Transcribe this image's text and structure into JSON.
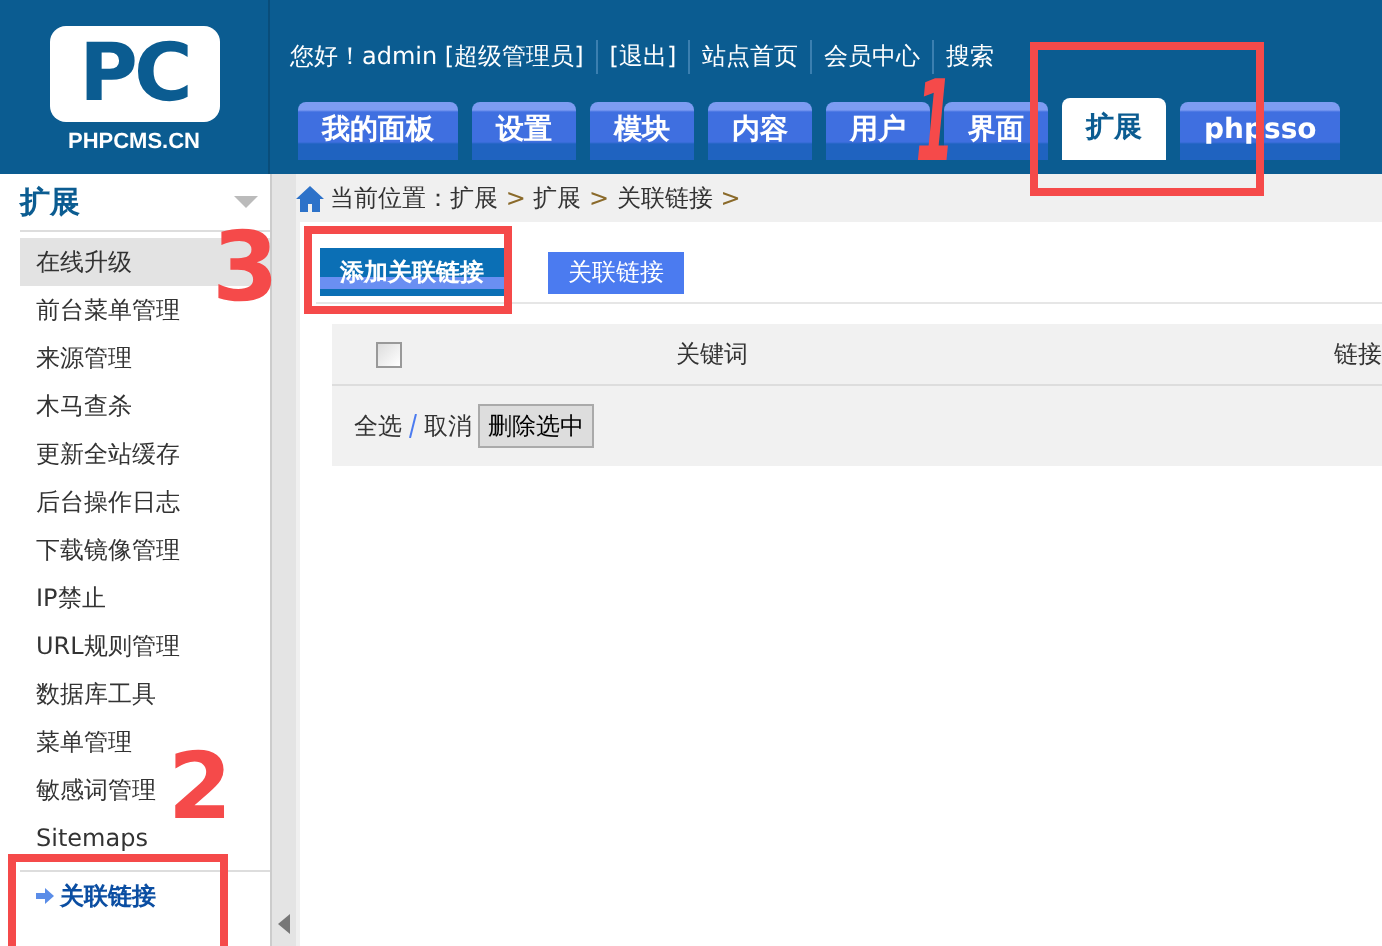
{
  "logo": {
    "mark": "PC",
    "caption": "PHPCMS.CN"
  },
  "top_links": [
    {
      "text": "您好！admin [超级管理员]"
    },
    {
      "text": "[退出]"
    },
    {
      "text": "站点首页"
    },
    {
      "text": "会员中心"
    },
    {
      "text": "搜索"
    }
  ],
  "tabs": [
    {
      "label": "我的面板",
      "selected": false
    },
    {
      "label": "设置",
      "selected": false
    },
    {
      "label": "模块",
      "selected": false
    },
    {
      "label": "内容",
      "selected": false
    },
    {
      "label": "用户",
      "selected": false
    },
    {
      "label": "界面",
      "selected": false
    },
    {
      "label": "扩展",
      "selected": true
    },
    {
      "label": "phpsso",
      "selected": false
    }
  ],
  "sidebar": {
    "title": "扩展",
    "items": [
      {
        "label": "在线升级",
        "selected": false,
        "highlighted": true
      },
      {
        "label": "前台菜单管理",
        "selected": false,
        "highlighted": false
      },
      {
        "label": "来源管理",
        "selected": false,
        "highlighted": false
      },
      {
        "label": "木马查杀",
        "selected": false,
        "highlighted": false
      },
      {
        "label": "更新全站缓存",
        "selected": false,
        "highlighted": false
      },
      {
        "label": "后台操作日志",
        "selected": false,
        "highlighted": false
      },
      {
        "label": "下载镜像管理",
        "selected": false,
        "highlighted": false
      },
      {
        "label": "IP禁止",
        "selected": false,
        "highlighted": false
      },
      {
        "label": "URL规则管理",
        "selected": false,
        "highlighted": false
      },
      {
        "label": "数据库工具",
        "selected": false,
        "highlighted": false
      },
      {
        "label": "菜单管理",
        "selected": false,
        "highlighted": false
      },
      {
        "label": "敏感词管理",
        "selected": false,
        "highlighted": false
      },
      {
        "label": "Sitemaps",
        "selected": false,
        "highlighted": false
      },
      {
        "label": "关联链接",
        "selected": true,
        "highlighted": false
      }
    ]
  },
  "breadcrumb": {
    "label": "当前位置：",
    "parts": [
      "扩展",
      "扩展",
      "关联链接"
    ],
    "separator": ">"
  },
  "subtabs": [
    {
      "label": "添加关联链接",
      "selected": true
    },
    {
      "label": "关联链接",
      "selected": false
    }
  ],
  "table": {
    "select_all_checked": false,
    "columns": [
      "关键词",
      "链接"
    ]
  },
  "footer": {
    "select_label": "全选",
    "cancel_label": "取消",
    "delete_button": "删除选中"
  },
  "annotations": [
    {
      "kind": "number",
      "text": "1"
    },
    {
      "kind": "box"
    },
    {
      "kind": "number",
      "text": "3"
    },
    {
      "kind": "box"
    },
    {
      "kind": "number",
      "text": "2"
    },
    {
      "kind": "box"
    }
  ]
}
